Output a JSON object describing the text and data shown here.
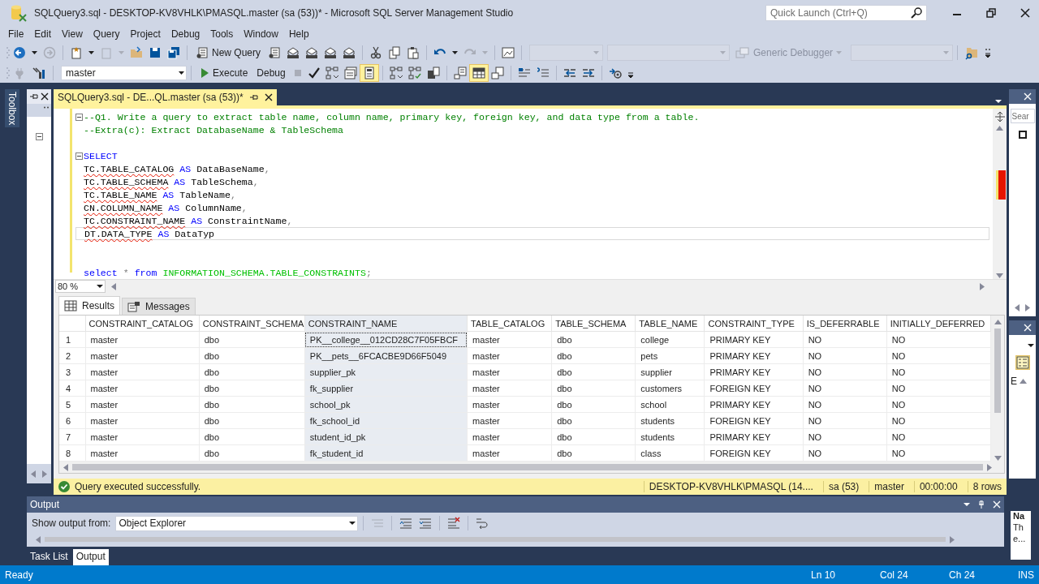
{
  "window": {
    "title": "SQLQuery3.sql - DESKTOP-KV8VHLK\\PMASQL.master (sa (53))* - Microsoft SQL Server Management Studio"
  },
  "quick_launch": {
    "placeholder": "Quick Launch (Ctrl+Q)"
  },
  "menu": [
    "File",
    "Edit",
    "View",
    "Query",
    "Project",
    "Debug",
    "Tools",
    "Window",
    "Help"
  ],
  "toolbar": {
    "new_query": "New Query",
    "debugger": {
      "label": "Generic Debugger",
      "disabled": true
    }
  },
  "sql_toolbar": {
    "database": "master",
    "execute": "Execute",
    "debug": "Debug",
    "plan_toggles": [
      {
        "selected": false
      },
      {
        "selected": false
      },
      {
        "selected": true
      }
    ],
    "result_toggles": [
      {
        "selected": false
      },
      {
        "selected": true
      },
      {
        "selected": false
      }
    ]
  },
  "toolbox": {
    "label": "Toolbox"
  },
  "editor": {
    "tab": {
      "title": "SQLQuery3.sql - DE...QL.master (sa (53))*",
      "selected": true
    },
    "lines": [
      {
        "kind": "code",
        "fold": true,
        "current": false,
        "tokens": [
          {
            "text": "--Q1. Write a query to extract table name, column name, primary key, foreign key, and data type from a table.",
            "kind": "comment"
          }
        ]
      },
      {
        "kind": "code",
        "fold": false,
        "current": false,
        "tokens": [
          {
            "text": "--Extra(c): Extract DatabaseName & TableSchema",
            "kind": "comment"
          }
        ]
      },
      {
        "kind": "blank",
        "fold": false,
        "current": false
      },
      {
        "kind": "code",
        "fold": true,
        "current": false,
        "tokens": [
          {
            "text": "SELECT",
            "kind": "keyword"
          }
        ]
      },
      {
        "kind": "code",
        "fold": false,
        "current": false,
        "tokens": [
          {
            "text": "TC.TABLE_CATALOG",
            "kind": "unresolved"
          },
          {
            "text": " AS ",
            "kind": "keyword"
          },
          {
            "text": "DataBaseName",
            "kind": "ident"
          },
          {
            "text": ",",
            "kind": "punct"
          }
        ]
      },
      {
        "kind": "code",
        "fold": false,
        "current": false,
        "tokens": [
          {
            "text": "TC.TABLE_SCHEMA",
            "kind": "unresolved"
          },
          {
            "text": " AS ",
            "kind": "keyword"
          },
          {
            "text": "TableSchema",
            "kind": "ident"
          },
          {
            "text": ",",
            "kind": "punct"
          }
        ]
      },
      {
        "kind": "code",
        "fold": false,
        "current": false,
        "tokens": [
          {
            "text": "TC.TABLE_NAME",
            "kind": "unresolved"
          },
          {
            "text": " AS ",
            "kind": "keyword"
          },
          {
            "text": "TableName",
            "kind": "ident"
          },
          {
            "text": ",",
            "kind": "punct"
          }
        ]
      },
      {
        "kind": "code",
        "fold": false,
        "current": false,
        "tokens": [
          {
            "text": "CN.COLUMN_NAME",
            "kind": "unresolved"
          },
          {
            "text": " AS ",
            "kind": "keyword"
          },
          {
            "text": "ColumnName",
            "kind": "ident"
          },
          {
            "text": ",",
            "kind": "punct"
          }
        ]
      },
      {
        "kind": "code",
        "fold": false,
        "current": false,
        "tokens": [
          {
            "text": "TC.CONSTRAINT_NAME",
            "kind": "unresolved"
          },
          {
            "text": " AS ",
            "kind": "keyword"
          },
          {
            "text": "ConstraintName",
            "kind": "ident"
          },
          {
            "text": ",",
            "kind": "punct"
          }
        ]
      },
      {
        "kind": "code",
        "fold": false,
        "current": true,
        "tokens": [
          {
            "text": "DT.DATA_TYPE",
            "kind": "unresolved"
          },
          {
            "text": " AS ",
            "kind": "keyword"
          },
          {
            "text": "DataTyp",
            "kind": "ident"
          }
        ]
      },
      {
        "kind": "blank",
        "fold": false,
        "current": false
      },
      {
        "kind": "blank",
        "fold": false,
        "current": false
      },
      {
        "kind": "code",
        "fold": false,
        "current": false,
        "tokens": [
          {
            "text": "select",
            "kind": "keyword"
          },
          {
            "text": " * ",
            "kind": "punct"
          },
          {
            "text": "from ",
            "kind": "keyword"
          },
          {
            "text": "INFORMATION_SCHEMA.TABLE_CONSTRAINTS",
            "kind": "system"
          },
          {
            "text": ";",
            "kind": "punct"
          }
        ]
      }
    ],
    "zoom": "80 %"
  },
  "results": {
    "tabs": [
      {
        "label": "Results",
        "selected": true
      },
      {
        "label": "Messages",
        "selected": false
      }
    ],
    "columns": [
      {
        "label": "CONSTRAINT_CATALOG",
        "selected": false
      },
      {
        "label": "CONSTRAINT_SCHEMA",
        "selected": false
      },
      {
        "label": "CONSTRAINT_NAME",
        "selected": true
      },
      {
        "label": "TABLE_CATALOG",
        "selected": false
      },
      {
        "label": "TABLE_SCHEMA",
        "selected": false
      },
      {
        "label": "TABLE_NAME",
        "selected": false
      },
      {
        "label": "CONSTRAINT_TYPE",
        "selected": false
      },
      {
        "label": "IS_DEFERRABLE",
        "selected": false
      },
      {
        "label": "INITIALLY_DEFERRED",
        "selected": false
      }
    ],
    "rows": [
      {
        "number": "1",
        "focused": true,
        "cells": [
          "master",
          "dbo",
          "PK__college__012CD28C7F05FBCF",
          "master",
          "dbo",
          "college",
          "PRIMARY KEY",
          "NO",
          "NO"
        ]
      },
      {
        "number": "2",
        "focused": false,
        "cells": [
          "master",
          "dbo",
          "PK__pets__6FCACBE9D66F5049",
          "master",
          "dbo",
          "pets",
          "PRIMARY KEY",
          "NO",
          "NO"
        ]
      },
      {
        "number": "3",
        "focused": false,
        "cells": [
          "master",
          "dbo",
          "supplier_pk",
          "master",
          "dbo",
          "supplier",
          "PRIMARY KEY",
          "NO",
          "NO"
        ]
      },
      {
        "number": "4",
        "focused": false,
        "cells": [
          "master",
          "dbo",
          "fk_supplier",
          "master",
          "dbo",
          "customers",
          "FOREIGN KEY",
          "NO",
          "NO"
        ]
      },
      {
        "number": "5",
        "focused": false,
        "cells": [
          "master",
          "dbo",
          "school_pk",
          "master",
          "dbo",
          "school",
          "PRIMARY KEY",
          "NO",
          "NO"
        ]
      },
      {
        "number": "6",
        "focused": false,
        "cells": [
          "master",
          "dbo",
          "fk_school_id",
          "master",
          "dbo",
          "students",
          "FOREIGN KEY",
          "NO",
          "NO"
        ]
      },
      {
        "number": "7",
        "focused": false,
        "cells": [
          "master",
          "dbo",
          "student_id_pk",
          "master",
          "dbo",
          "students",
          "PRIMARY KEY",
          "NO",
          "NO"
        ]
      },
      {
        "number": "8",
        "focused": false,
        "cells": [
          "master",
          "dbo",
          "fk_student_id",
          "master",
          "dbo",
          "class",
          "FOREIGN KEY",
          "NO",
          "NO"
        ]
      }
    ],
    "status": {
      "message": "Query executed successfully.",
      "server": "DESKTOP-KV8VHLK\\PMASQL (14....",
      "user": "sa (53)",
      "database": "master",
      "elapsed": "00:00:00",
      "rows": "8 rows"
    }
  },
  "output": {
    "title": "Output",
    "source_label": "Show output from:",
    "source": "Object Explorer",
    "tabs": [
      {
        "label": "Task List",
        "selected": false
      },
      {
        "label": "Output",
        "selected": true
      }
    ]
  },
  "side_panel": {
    "search": {
      "placeholder": "Sear"
    },
    "letter": "E",
    "notes": [
      "Na",
      "Th",
      "e..."
    ]
  },
  "status_bar": {
    "message": "Ready",
    "line": "Ln 10",
    "column": "Col 24",
    "char": "Ch 24",
    "mode": "INS"
  }
}
